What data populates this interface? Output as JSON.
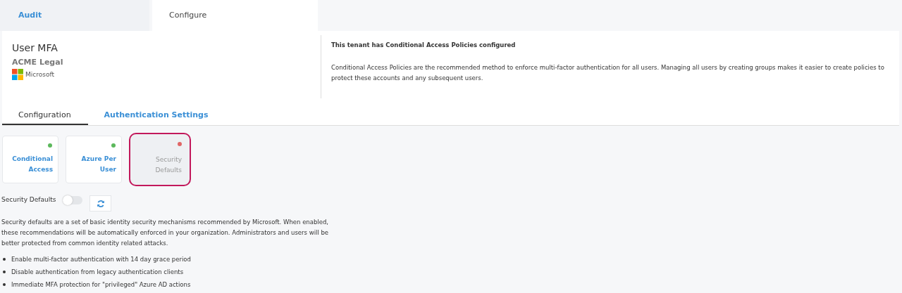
{
  "tabs": [
    {
      "label": "Audit",
      "selected": false
    },
    {
      "label": "Configure",
      "selected": true
    }
  ],
  "header": {
    "title": "User MFA",
    "tenant": "ACME Legal",
    "provider": "Microsoft",
    "notice_title": "This tenant has Conditional Access Policies configured",
    "notice_text": "Conditional Access Policies are the recommended method to enforce multi-factor authentication for all users. Managing all users by creating groups makes it easier to create policies to protect these accounts and any subsequent users."
  },
  "subtabs": [
    {
      "label": "Configuration",
      "selected": true
    },
    {
      "label": "Authentication Settings",
      "selected": false
    }
  ],
  "methods": [
    {
      "label": "Conditional Access",
      "color": "#5cb85c",
      "selected": false
    },
    {
      "label": "Azure Per User",
      "color": "#5cb85c",
      "selected": false
    },
    {
      "label": "Security Defaults",
      "color": "#e06666",
      "selected": true
    }
  ],
  "toggle": {
    "label": "Security Defaults",
    "on": false
  },
  "description": "Security defaults are a set of basic identity security mechanisms recommended by Microsoft. When enabled, these recommendations will be automatically enforced in your organization. Administrators and users will be better protected from common identity related attacks.",
  "bullets": [
    "Enable multi-factor authentication with 14 day grace period",
    "Disable authentication from legacy authentication clients",
    "Immediate MFA protection for \"privileged\" Azure AD actions"
  ]
}
